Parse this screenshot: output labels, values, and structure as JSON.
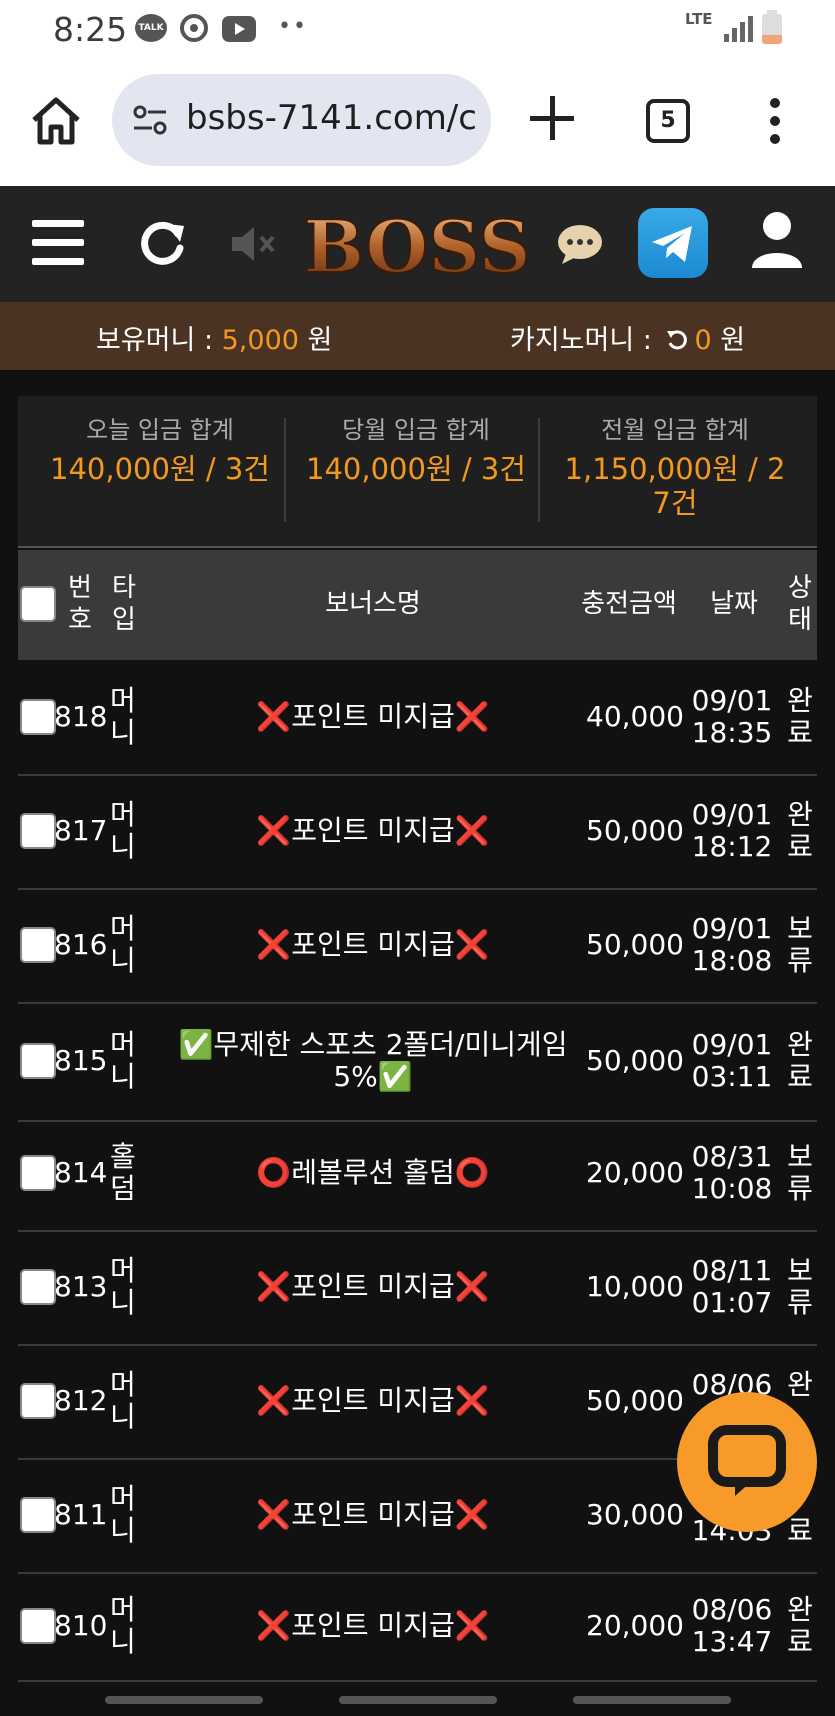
{
  "status_bar": {
    "time": "8:25",
    "talk_label": "TALK",
    "network": "LTE",
    "icons": [
      "talk-icon",
      "sync-icon",
      "youtube-icon",
      "more-dots-icon",
      "lte-icon",
      "signal-icon",
      "battery-icon"
    ]
  },
  "browser": {
    "url": "bsbs-7141.com/c",
    "tab_count": "5"
  },
  "site": {
    "logo_text": "BOSS",
    "money_label": "보유머니 : ",
    "money_value": "5,000",
    "money_unit": " 원",
    "casino_label": "카지노머니 : ",
    "casino_value": "0",
    "casino_unit": " 원"
  },
  "summary": [
    {
      "label": "오늘 입금 합계",
      "value": "140,000원 / 3건"
    },
    {
      "label": "당월 입금 합계",
      "value": "140,000원 / 3건"
    },
    {
      "label": "전월 입금 합계",
      "value_line1": "1,150,000원 / 2",
      "value_line2": "7건"
    }
  ],
  "table": {
    "headers": {
      "num_1": "번",
      "num_2": "호",
      "type_1": "타",
      "type_2": "입",
      "name": "보너스명",
      "amount": "충전금액",
      "date": "날짜",
      "status_1": "상",
      "status_2": "태"
    },
    "rows": [
      {
        "num": "818",
        "type_1": "머",
        "type_2": "니",
        "name_1": "❌포인트 미지급❌",
        "name_2": "",
        "amount": "40,000",
        "date_1": "09/01",
        "date_2": "18:35",
        "status_1": "완",
        "status_2": "료"
      },
      {
        "num": "817",
        "type_1": "머",
        "type_2": "니",
        "name_1": "❌포인트 미지급❌",
        "name_2": "",
        "amount": "50,000",
        "date_1": "09/01",
        "date_2": "18:12",
        "status_1": "완",
        "status_2": "료"
      },
      {
        "num": "816",
        "type_1": "머",
        "type_2": "니",
        "name_1": "❌포인트 미지급❌",
        "name_2": "",
        "amount": "50,000",
        "date_1": "09/01",
        "date_2": "18:08",
        "status_1": "보",
        "status_2": "류"
      },
      {
        "num": "815",
        "type_1": "머",
        "type_2": "니",
        "name_1": "✅무제한 스포츠 2폴더/미니게임",
        "name_2": "5%✅",
        "amount": "50,000",
        "date_1": "09/01",
        "date_2": "03:11",
        "status_1": "완",
        "status_2": "료"
      },
      {
        "num": "814",
        "type_1": "홀",
        "type_2": "덤",
        "name_1": "⭕레볼루션 홀덤⭕",
        "name_2": "",
        "amount": "20,000",
        "date_1": "08/31",
        "date_2": "10:08",
        "status_1": "보",
        "status_2": "류"
      },
      {
        "num": "813",
        "type_1": "머",
        "type_2": "니",
        "name_1": "❌포인트 미지급❌",
        "name_2": "",
        "amount": "10,000",
        "date_1": "08/11",
        "date_2": "01:07",
        "status_1": "보",
        "status_2": "류"
      },
      {
        "num": "812",
        "type_1": "머",
        "type_2": "니",
        "name_1": "❌포인트 미지급❌",
        "name_2": "",
        "amount": "50,000",
        "date_1": "08/06",
        "date_2": "",
        "status_1": "완",
        "status_2": ""
      },
      {
        "num": "811",
        "type_1": "머",
        "type_2": "니",
        "name_1": "❌포인트 미지급❌",
        "name_2": "",
        "amount": "30,000",
        "date_1": "",
        "date_2": "14:03",
        "status_1": "",
        "status_2": "료"
      },
      {
        "num": "810",
        "type_1": "머",
        "type_2": "니",
        "name_1": "❌포인트 미지급❌",
        "name_2": "",
        "amount": "20,000",
        "date_1": "08/06",
        "date_2": "13:47",
        "status_1": "완",
        "status_2": "료"
      }
    ]
  },
  "colors": {
    "accent_gold": "#f29a1d",
    "money_bar": "#4a3322",
    "header_bg": "#232323",
    "chat_fab": "#f79a2a",
    "telegram": "#2aa3e1"
  }
}
